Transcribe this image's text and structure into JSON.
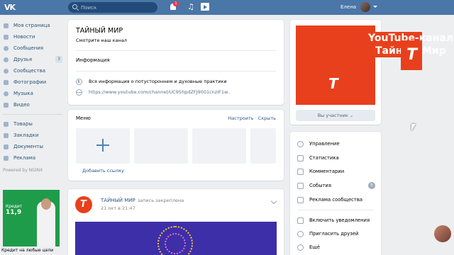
{
  "header": {
    "logo": "VK",
    "search_placeholder": "Поиск",
    "notifications_count": "1",
    "user_name": "Елена"
  },
  "sidebar": {
    "items": [
      {
        "label": "Моя страница",
        "icon": "home-icon"
      },
      {
        "label": "Новости",
        "icon": "news-icon"
      },
      {
        "label": "Сообщения",
        "icon": "message-icon"
      },
      {
        "label": "Друзья",
        "icon": "friends-icon",
        "badge": "3"
      },
      {
        "label": "Сообщества",
        "icon": "groups-icon"
      },
      {
        "label": "Фотографии",
        "icon": "photo-icon"
      },
      {
        "label": "Музыка",
        "icon": "music-icon"
      },
      {
        "label": "Видео",
        "icon": "video-icon"
      }
    ],
    "items2": [
      {
        "label": "Товары",
        "icon": "market-icon"
      },
      {
        "label": "Закладки",
        "icon": "star-icon"
      },
      {
        "label": "Документы",
        "icon": "document-icon"
      },
      {
        "label": "Реклама",
        "icon": "ads-icon"
      }
    ],
    "powered": "Powered by NGINX",
    "ad": {
      "line1": "Кредит",
      "rate": "11,9",
      "foot": "Кредит на любые цели"
    }
  },
  "profile": {
    "title": "ТАЙНЫЙ МИР",
    "status": "Смотрите наш канал",
    "info_heading": "Информация",
    "description": "Вся информация о потустороннем и духовные практики",
    "link": "https://www.youtube.com/channel/UC95hpdZFJ9001cnzIF1w.."
  },
  "menu": {
    "title": "Меню",
    "configure": "Настроить",
    "hide": "Скрыть",
    "add_link": "Добавить ссылку"
  },
  "post": {
    "author": "ТАЙНЫЙ МИР",
    "note": "запись закреплена",
    "date": "21 окт в 21:47"
  },
  "cover": {
    "line1": "YouTube-канал",
    "line2": "Тайный Мир",
    "member_button": "Вы участник"
  },
  "manage": {
    "items": [
      {
        "label": "Управление",
        "icon": "gear-icon"
      },
      {
        "label": "Статистика",
        "icon": "stats-icon"
      },
      {
        "label": "Комментарии",
        "icon": "comment-icon"
      },
      {
        "label": "События",
        "icon": "events-icon",
        "badge": "5"
      },
      {
        "label": "Реклама сообщества",
        "icon": "ads-icon"
      },
      {
        "label": "Включить уведомления",
        "icon": "bell-icon"
      },
      {
        "label": "Пригласить друзей",
        "icon": "invite-icon"
      },
      {
        "label": "Ещё",
        "icon": "more-icon"
      }
    ]
  },
  "colors": {
    "header": "#4a76a8",
    "accent": "#e8401c",
    "link": "#2a5885"
  }
}
